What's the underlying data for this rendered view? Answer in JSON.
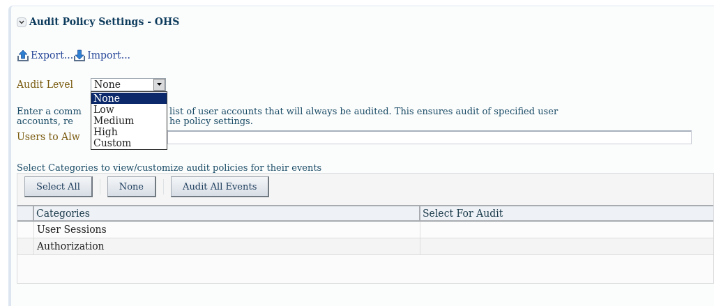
{
  "panel": {
    "title": "Audit Policy Settings - OHS",
    "expanded": true
  },
  "actions": [
    {
      "kind": "export",
      "label": "Export..."
    },
    {
      "kind": "import",
      "label": "Import..."
    }
  ],
  "audit_level": {
    "label": "Audit Level",
    "value": "None",
    "open": true,
    "options": [
      {
        "label": "None",
        "selected": true
      },
      {
        "label": "Low",
        "selected": false
      },
      {
        "label": "Medium",
        "selected": false
      },
      {
        "label": "High",
        "selected": false
      },
      {
        "label": "Custom",
        "selected": false
      }
    ]
  },
  "description": [
    [
      "Enter a comm",
      "list of user accounts that will always be audited. This ensures audit of specified user"
    ],
    [
      "accounts, re",
      "he policy settings."
    ]
  ],
  "users_field": {
    "label": "Users to Alw"
  },
  "categories": {
    "caption": "Select Categories to view/customize audit policies for their events",
    "buttons": [
      "Select All",
      "None",
      "Audit All Events"
    ],
    "columns": [
      "Categories",
      "Select For Audit"
    ],
    "rows": [
      [
        "User Sessions",
        ""
      ],
      [
        "Authorization",
        ""
      ]
    ]
  }
}
